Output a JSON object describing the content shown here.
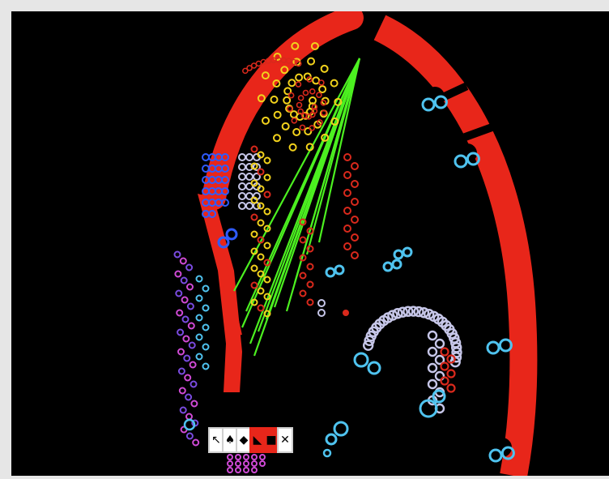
{
  "display": {
    "background": "#000000",
    "frame_color": "#e6e6e6"
  },
  "palette": {
    "ring": "#e8261a",
    "link_lines": "#4cf020",
    "ring_token": "#4fc3ef",
    "inner_token_a": "#f2d21c",
    "inner_token_b": "#2f5bff",
    "inner_token_c": "#c6c6e8",
    "inner_token_d": "#d04ad6",
    "inner_token_e": "#d9291c"
  },
  "toolbar": {
    "tools": [
      {
        "icon": "cursor-icon",
        "glyph": "↖",
        "style": "light"
      },
      {
        "icon": "pick-icon",
        "glyph": "♠",
        "style": "light"
      },
      {
        "icon": "diamond-icon",
        "glyph": "◆",
        "style": "light"
      },
      {
        "icon": "half-square-icon",
        "glyph": "◣",
        "style": "dark"
      },
      {
        "icon": "square-icon",
        "glyph": "■",
        "style": "dark"
      },
      {
        "icon": "close-icon",
        "glyph": "✕",
        "style": "light"
      }
    ]
  }
}
